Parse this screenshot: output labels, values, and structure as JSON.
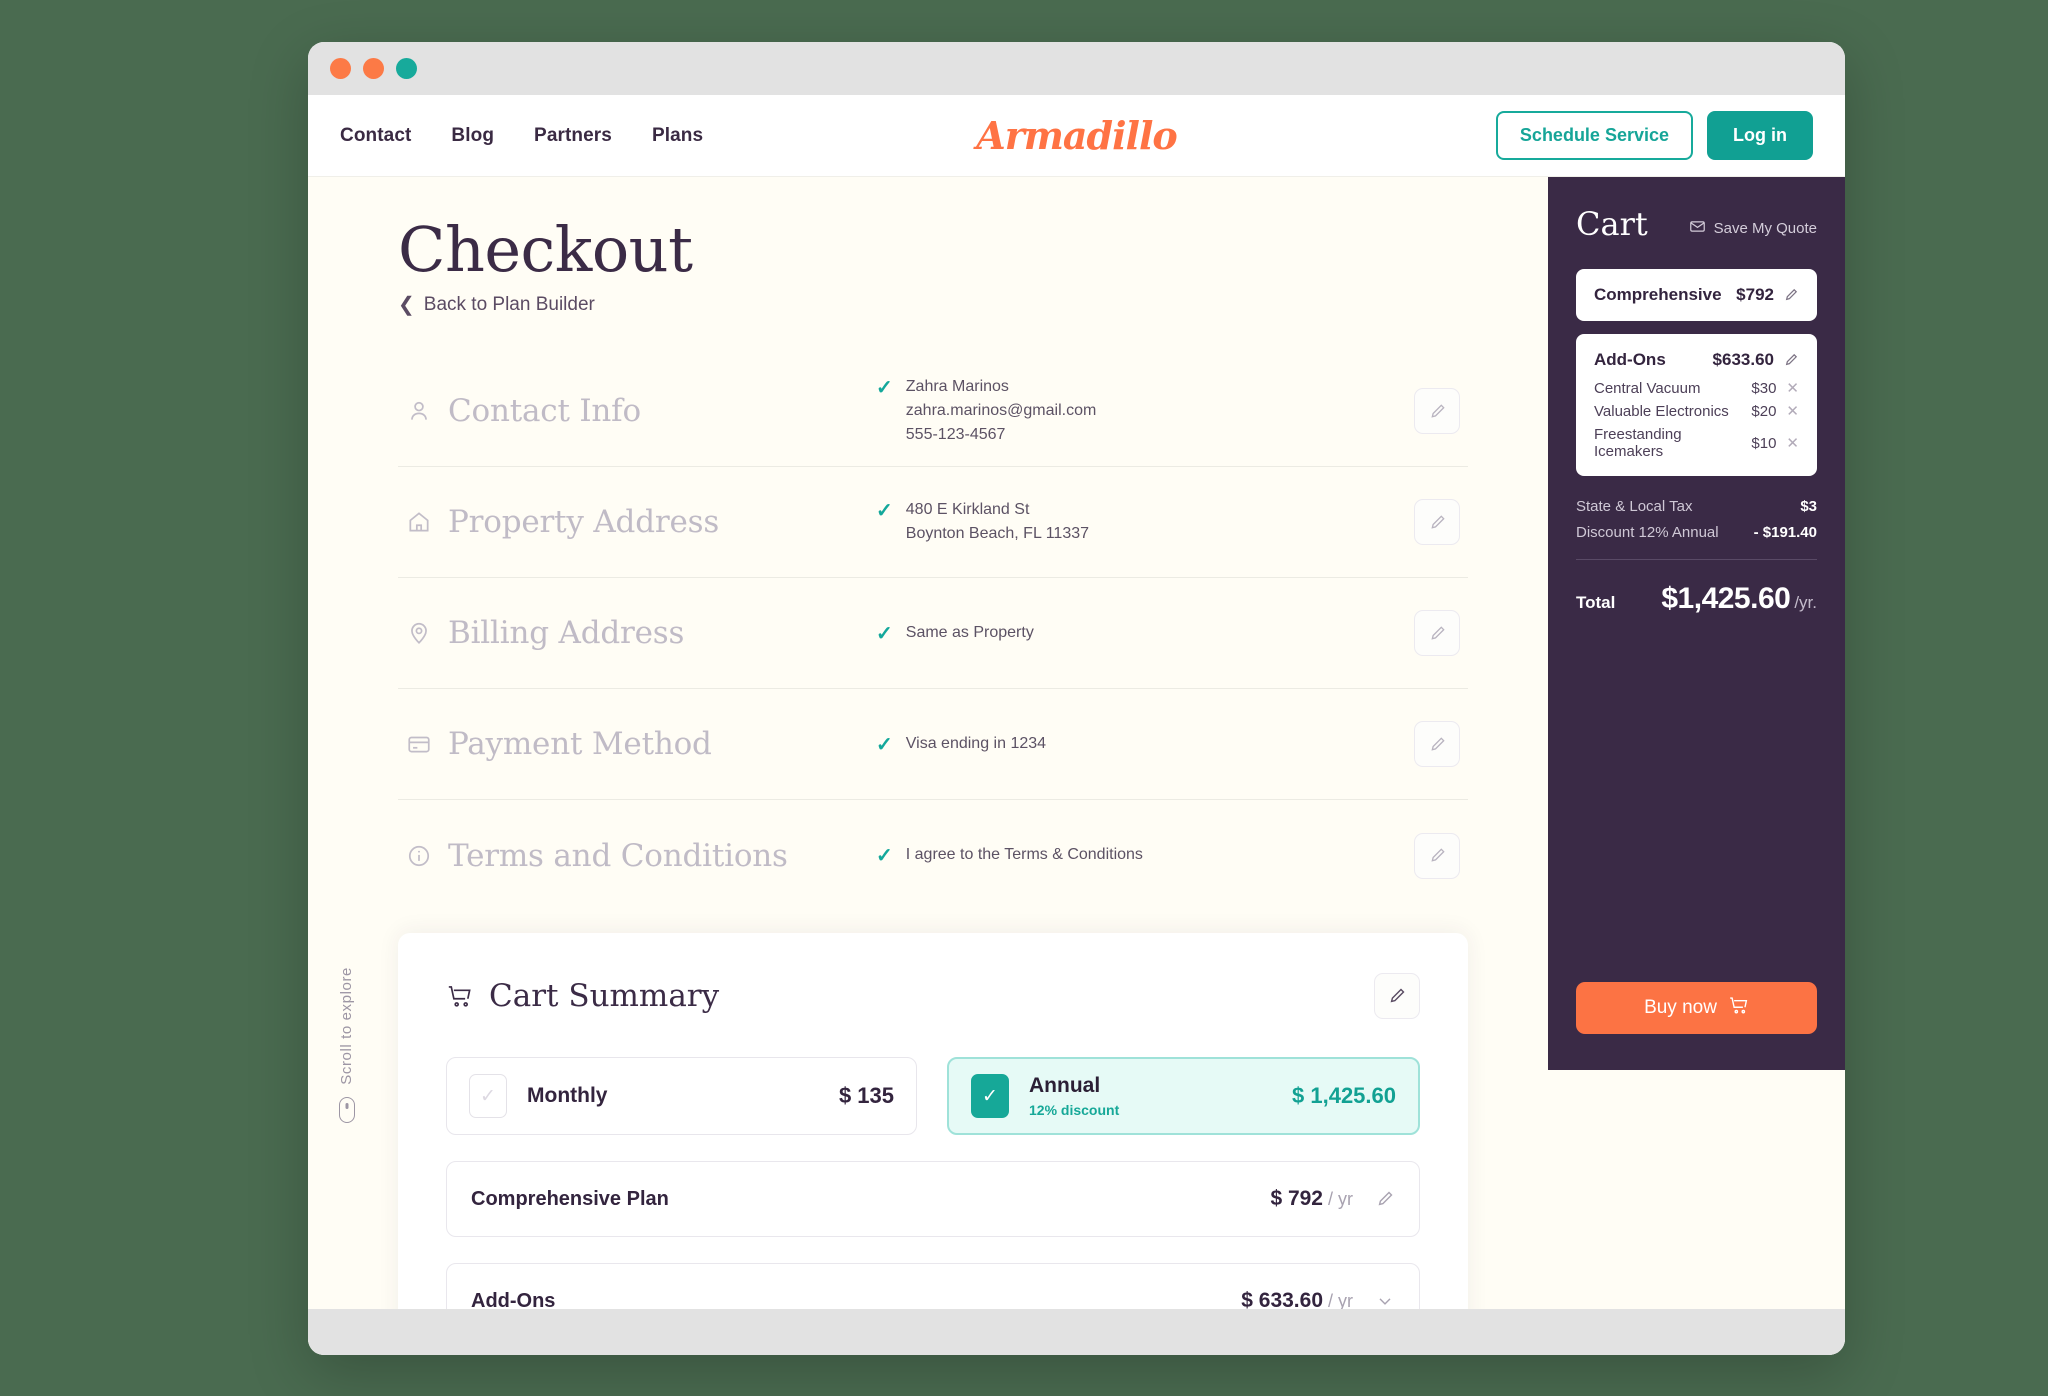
{
  "nav": {
    "links": [
      "Contact",
      "Blog",
      "Partners",
      "Plans"
    ],
    "logo": "Armadillo",
    "schedule_label": "Schedule Service",
    "login_label": "Log in"
  },
  "main": {
    "title": "Checkout",
    "back_label": "Back to Plan Builder",
    "scroll_hint": "Scroll to explore"
  },
  "sections": [
    {
      "icon": "person-icon",
      "title": "Contact Info",
      "values": [
        "Zahra Marinos",
        "zahra.marinos@gmail.com",
        "555-123-4567"
      ]
    },
    {
      "icon": "home-icon",
      "title": "Property Address",
      "values": [
        "480 E Kirkland St",
        "Boynton Beach, FL 11337"
      ]
    },
    {
      "icon": "pin-icon",
      "title": "Billing Address",
      "values": [
        "Same as Property"
      ]
    },
    {
      "icon": "card-icon",
      "title": "Payment Method",
      "values": [
        "Visa ending in 1234"
      ]
    },
    {
      "icon": "info-icon",
      "title": "Terms and Conditions",
      "values": [
        "I agree to the Terms & Conditions"
      ]
    }
  ],
  "cart_summary": {
    "title": "Cart Summary",
    "toggles": [
      {
        "name": "Monthly",
        "sub": "",
        "price": "$ 135",
        "selected": false
      },
      {
        "name": "Annual",
        "sub": "12% discount",
        "price": "$ 1,425.60",
        "selected": true
      }
    ],
    "lines": [
      {
        "name": "Comprehensive Plan",
        "price": "$ 792",
        "per": "/ yr",
        "action": "pencil-icon"
      },
      {
        "name": "Add-Ons",
        "price": "$ 633.60",
        "per": "/ yr",
        "action": "chevron-down-icon"
      }
    ]
  },
  "cart": {
    "title": "Cart",
    "save_quote_label": "Save My Quote",
    "plan": {
      "name": "Comprehensive",
      "price": "$792"
    },
    "addons": {
      "name": "Add-Ons",
      "price": "$633.60",
      "items": [
        {
          "name": "Central Vacuum",
          "price": "$30"
        },
        {
          "name": "Valuable Electronics",
          "price": "$20"
        },
        {
          "name": "Freestanding Icemakers",
          "price": "$10"
        }
      ]
    },
    "totals": [
      {
        "label": "State & Local Tax",
        "value": "$3"
      },
      {
        "label": "Discount 12% Annual",
        "value": "- $191.40"
      }
    ],
    "total_label": "Total",
    "total_value": "$1,425.60",
    "total_per": "/yr.",
    "buy_label": "Buy now"
  },
  "colors": {
    "desktop_bg": "#4a6b50",
    "brand_orange": "#fc7344",
    "brand_teal": "#16a898",
    "cart_dark": "#3a2a46",
    "page_bg": "#fffdf5"
  }
}
